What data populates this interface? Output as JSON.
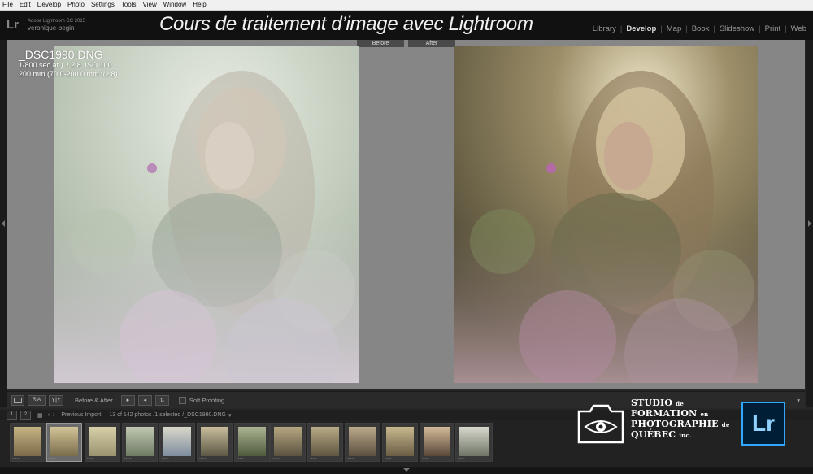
{
  "menubar": {
    "items": [
      "File",
      "Edit",
      "Develop",
      "Photo",
      "Settings",
      "Tools",
      "View",
      "Window",
      "Help"
    ]
  },
  "brand": {
    "logo": "Lr",
    "app_name": "Adobe Lightroom CC 2015",
    "user": "veronique-begin"
  },
  "course_title": "Cours de traitement d’image avec Lightroom",
  "modules": [
    "Library",
    "Develop",
    "Map",
    "Book",
    "Slideshow",
    "Print",
    "Web"
  ],
  "active_module": "Develop",
  "view": {
    "before_label": "Before",
    "after_label": "After"
  },
  "photo_info": {
    "filename": "_DSC1990.DNG",
    "exposure": "1/800 sec at ƒ / 2.8, ISO 100",
    "lens": "200 mm (70.0-200.0 mm f/2.8)"
  },
  "toolbar": {
    "view_button_labels": [
      "",
      "",
      "Y|Y"
    ],
    "before_after_label": "Before & After :",
    "soft_proofing_label": "Soft Proofing"
  },
  "filmstrip_header": {
    "page_buttons": [
      "1",
      "2"
    ],
    "source": "Previous Import",
    "status": "13 of 142 photos /1 selected /_DSC1990.DNG"
  },
  "filmstrip": {
    "thumbnail_count": 13,
    "selected_index": 1,
    "stars": "•••••"
  },
  "overlay_logo": {
    "lines": [
      "STUDIO",
      "de",
      "FORMATION",
      "en",
      "PHOTOGRAPHIE",
      "de",
      "QUÉBEC",
      "inc."
    ]
  },
  "lr_badge": "Lr",
  "colors": {
    "panel": "#262626",
    "canvas": "#868686",
    "badge_bg": "#001e36",
    "badge_accent": "#31a8ff"
  }
}
